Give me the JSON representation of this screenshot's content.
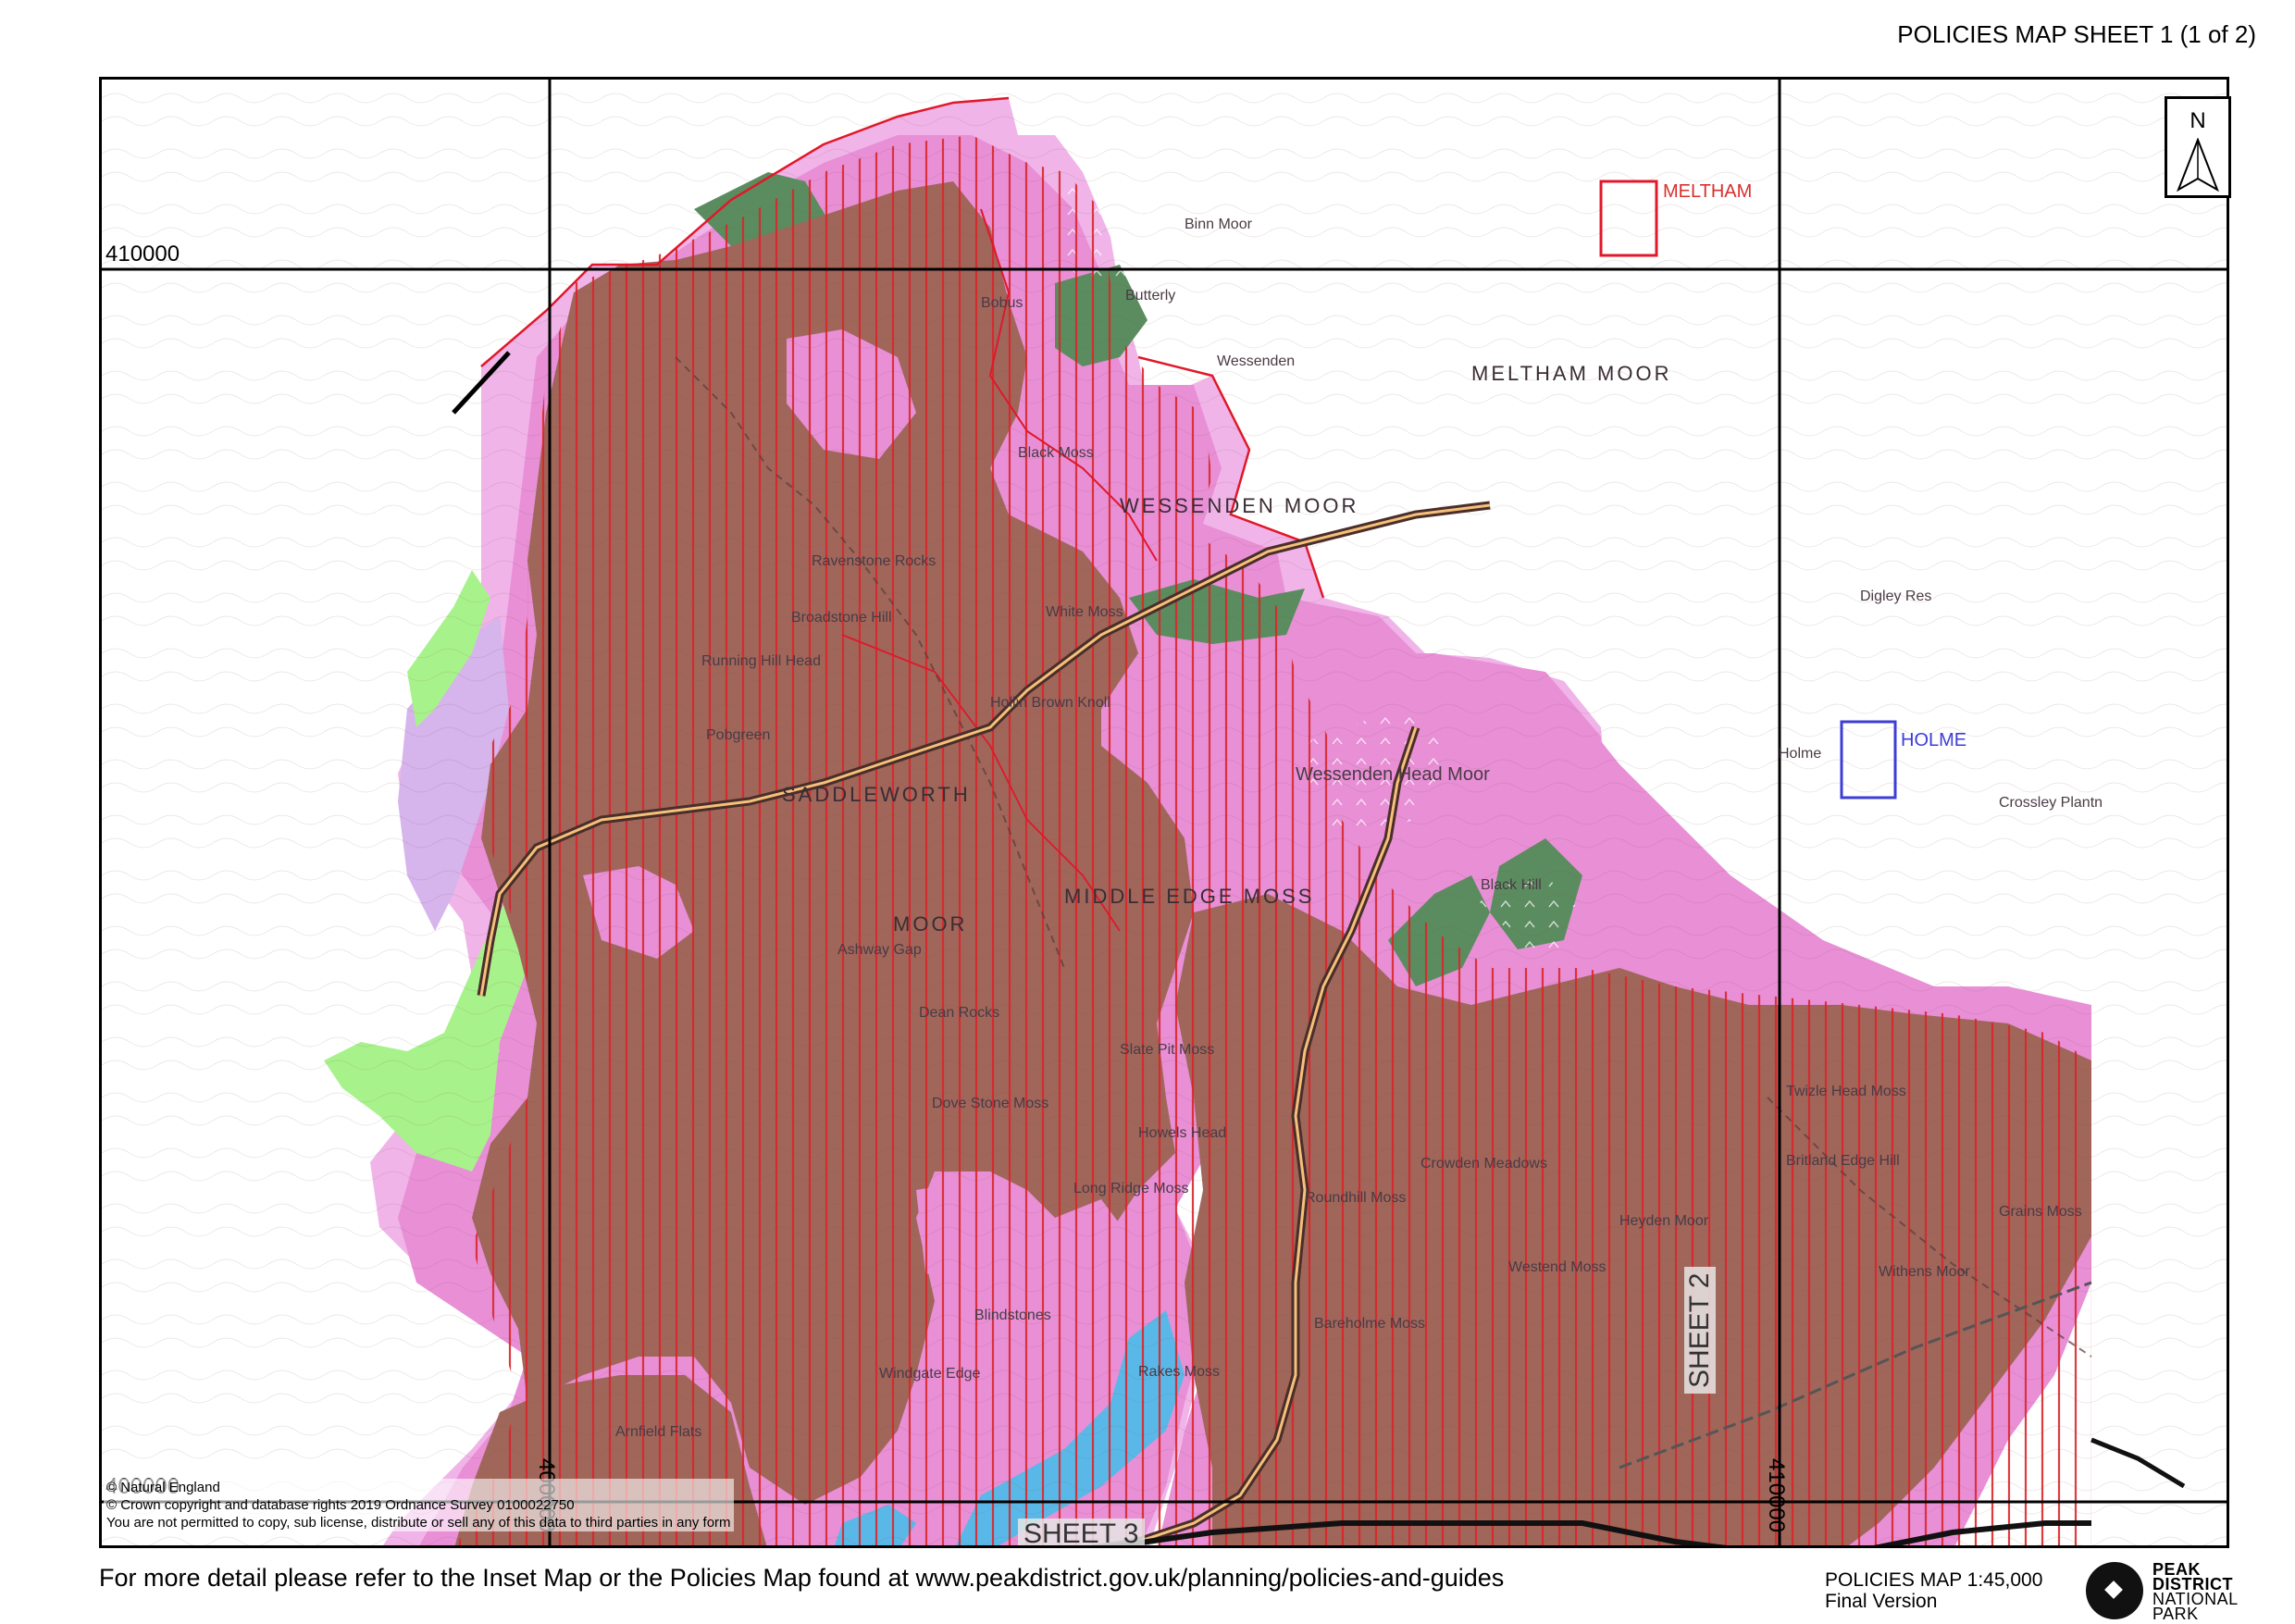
{
  "header": {
    "title": "POLICIES MAP SHEET 1 (1 of 2)"
  },
  "grid": {
    "northing_labels": [
      "410000",
      "400000"
    ],
    "easting_labels": [
      "400000",
      "410000"
    ]
  },
  "north_arrow": {
    "label": "N",
    "icon": "north-arrow-icon"
  },
  "insets": {
    "meltham": "MELTHAM",
    "holme": "HOLME"
  },
  "sheet_refs": {
    "sheet2": "SHEET 2",
    "sheet3": "SHEET 3"
  },
  "place_names": {
    "wessenden_moor": "WESSENDEN MOOR",
    "meltham_moor": "MELTHAM MOOR",
    "saddleworth": "SADDLEWORTH",
    "moor": "MOOR",
    "middle_edge_moss": "MIDDLE EDGE MOSS",
    "wessenden_head_moor": "Wessenden Head Moor",
    "black_moss": "Black Moss",
    "white_moss": "White Moss",
    "binn_moor": "Binn Moor",
    "bobus": "Bobus",
    "butterly": "Butterly",
    "wessenden": "Wessenden",
    "black_hill": "Black Hill",
    "holme": "Holme",
    "dean_rocks": "Dean Rocks",
    "dove_stone_moss": "Dove Stone Moss",
    "howels_head": "Howels Head",
    "long_ridge_moss": "Long Ridge Moss",
    "roundhill_moss": "Roundhill Moss",
    "slate_pit_moss": "Slate Pit Moss",
    "bareholme_moss": "Bareholme Moss",
    "westend_moss": "Westend Moss",
    "withens_moor": "Withens Moor",
    "britland_edge_hill": "Britland Edge Hill",
    "twizle_head_moss": "Twizle Head Moss",
    "grains_moss": "Grains Moss",
    "arnfield_flats": "Arnfield Flats",
    "windgate_edge": "Windgate Edge",
    "blindstones": "Blindstones",
    "rakes_moss": "Rakes Moss",
    "crowden_meadows": "Crowden Meadows",
    "heyden_moor": "Heyden Moor",
    "ravenstone_rocks": "Ravenstone Rocks",
    "broadstone_hill": "Broadstone Hill",
    "running_hill_head": "Running Hill Head",
    "pobgreen": "Pobgreen",
    "ashway_gap": "Ashway Gap",
    "hollin_brown_knoll": "Hollin Brown Knoll",
    "digley_res": "Digley Res",
    "crossley_plantn": "Crossley Plantn"
  },
  "copyright": {
    "line1": "© Natural England",
    "line2": "© Crown copyright and database rights 2019   Ordnance Survey 0100022750",
    "line3": "You are not permitted to copy, sub license, distribute or sell any of this data to third parties in any form"
  },
  "footer": {
    "note": "For more detail please refer to the Inset Map or the Policies Map found at www.peakdistrict.gov.uk/planning/policies-and-guides",
    "scale": "POLICIES MAP 1:45,000",
    "version": "Final Version"
  },
  "logo": {
    "line1": "PEAK",
    "line2": "DISTRICT",
    "line3": "NATIONAL",
    "line4": "PARK"
  },
  "colors": {
    "moorland_brown": "#a0665a",
    "pink_designation": "#e88fd6",
    "light_pink": "#f0b4e8",
    "woodland_green": "#5b8c5f",
    "meadow_green": "#a8f28c",
    "water_blue": "#5ab8e8",
    "hatch_red": "#d9262a",
    "boundary_red": "#e0182a"
  }
}
